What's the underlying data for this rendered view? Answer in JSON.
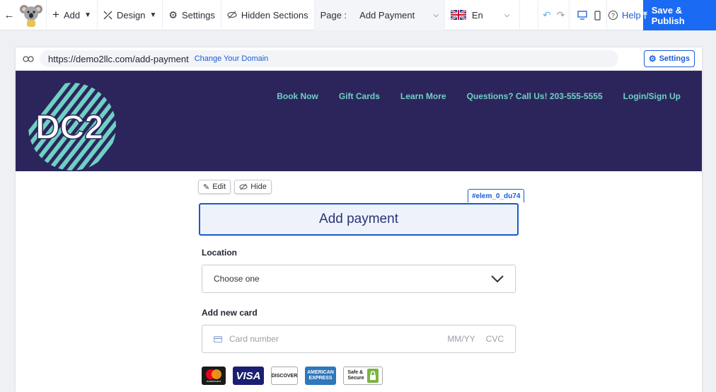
{
  "toolbar": {
    "add_label": "Add",
    "design_label": "Design",
    "settings_label": "Settings",
    "hidden_sections_label": "Hidden Sections",
    "page_prefix": "Page :",
    "page_name": "Add Payment",
    "language": "En",
    "help_label": "Help",
    "publish_label": "Save & Publish"
  },
  "urlbar": {
    "url": "https://demo2llc.com/add-payment",
    "change_domain": "Change Your Domain",
    "settings_label": "Settings"
  },
  "site": {
    "logo_text": "DC2",
    "nav": [
      "Book Now",
      "Gift Cards",
      "Learn More",
      "Questions? Call Us! 203-555-5555",
      "Login/Sign Up"
    ]
  },
  "editor": {
    "edit_label": "Edit",
    "hide_label": "Hide",
    "element_id": "#elem_0_du74"
  },
  "form": {
    "heading": "Add payment",
    "location_label": "Location",
    "location_value": "Choose one",
    "card_label": "Add new card",
    "card_number_placeholder": "Card number",
    "expiry_placeholder": "MM/YY",
    "cvc_placeholder": "CVC"
  },
  "badges": {
    "mastercard": "mastercard",
    "visa": "VISA",
    "discover": "DISCOVER",
    "amex_line1": "AMERICAN",
    "amex_line2": "EXPRESS",
    "safe_line1": "Safe &",
    "safe_line2": "Secure"
  },
  "colors": {
    "accent": "#1a6af4",
    "header_bg": "#2c255c",
    "nav_text": "#6fd0c3"
  }
}
